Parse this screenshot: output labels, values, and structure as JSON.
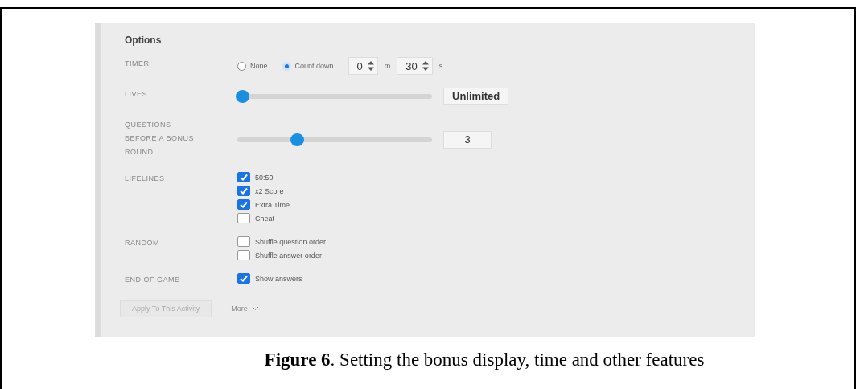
{
  "panel": {
    "title": "Options",
    "rows": [
      {
        "kind": "timer",
        "label": "TIMER",
        "radios": [
          {
            "label": "None",
            "selected": false
          },
          {
            "label": "Count down",
            "selected": true
          }
        ],
        "minutes": "0",
        "minutes_unit": "m",
        "seconds": "30",
        "seconds_unit": "s"
      },
      {
        "kind": "slider",
        "label": "LIVES",
        "level": 0,
        "value": "Unlimited"
      },
      {
        "kind": "slider",
        "label": "QUESTIONS BEFORE A BONUS ROUND",
        "level": 0.3,
        "value": "3"
      },
      {
        "kind": "checkboxes",
        "label": "LIFELINES",
        "items": [
          {
            "label": "50:50",
            "checked": true
          },
          {
            "label": "x2 Score",
            "checked": true
          },
          {
            "label": "Extra Time",
            "checked": true
          },
          {
            "label": "Cheat",
            "checked": false
          }
        ]
      },
      {
        "kind": "checkboxes",
        "label": "RANDOM",
        "items": [
          {
            "label": "Shuffle question order",
            "checked": false
          },
          {
            "label": "Shuffle answer order",
            "checked": false
          }
        ]
      },
      {
        "kind": "checkboxes",
        "label": "END OF GAME",
        "items": [
          {
            "label": "Show answers",
            "checked": true
          }
        ]
      }
    ],
    "apply_button": "Apply To This Activity",
    "more_button": "More"
  },
  "caption": "**Figure 6**. Setting the bonus display, time and other features"
}
